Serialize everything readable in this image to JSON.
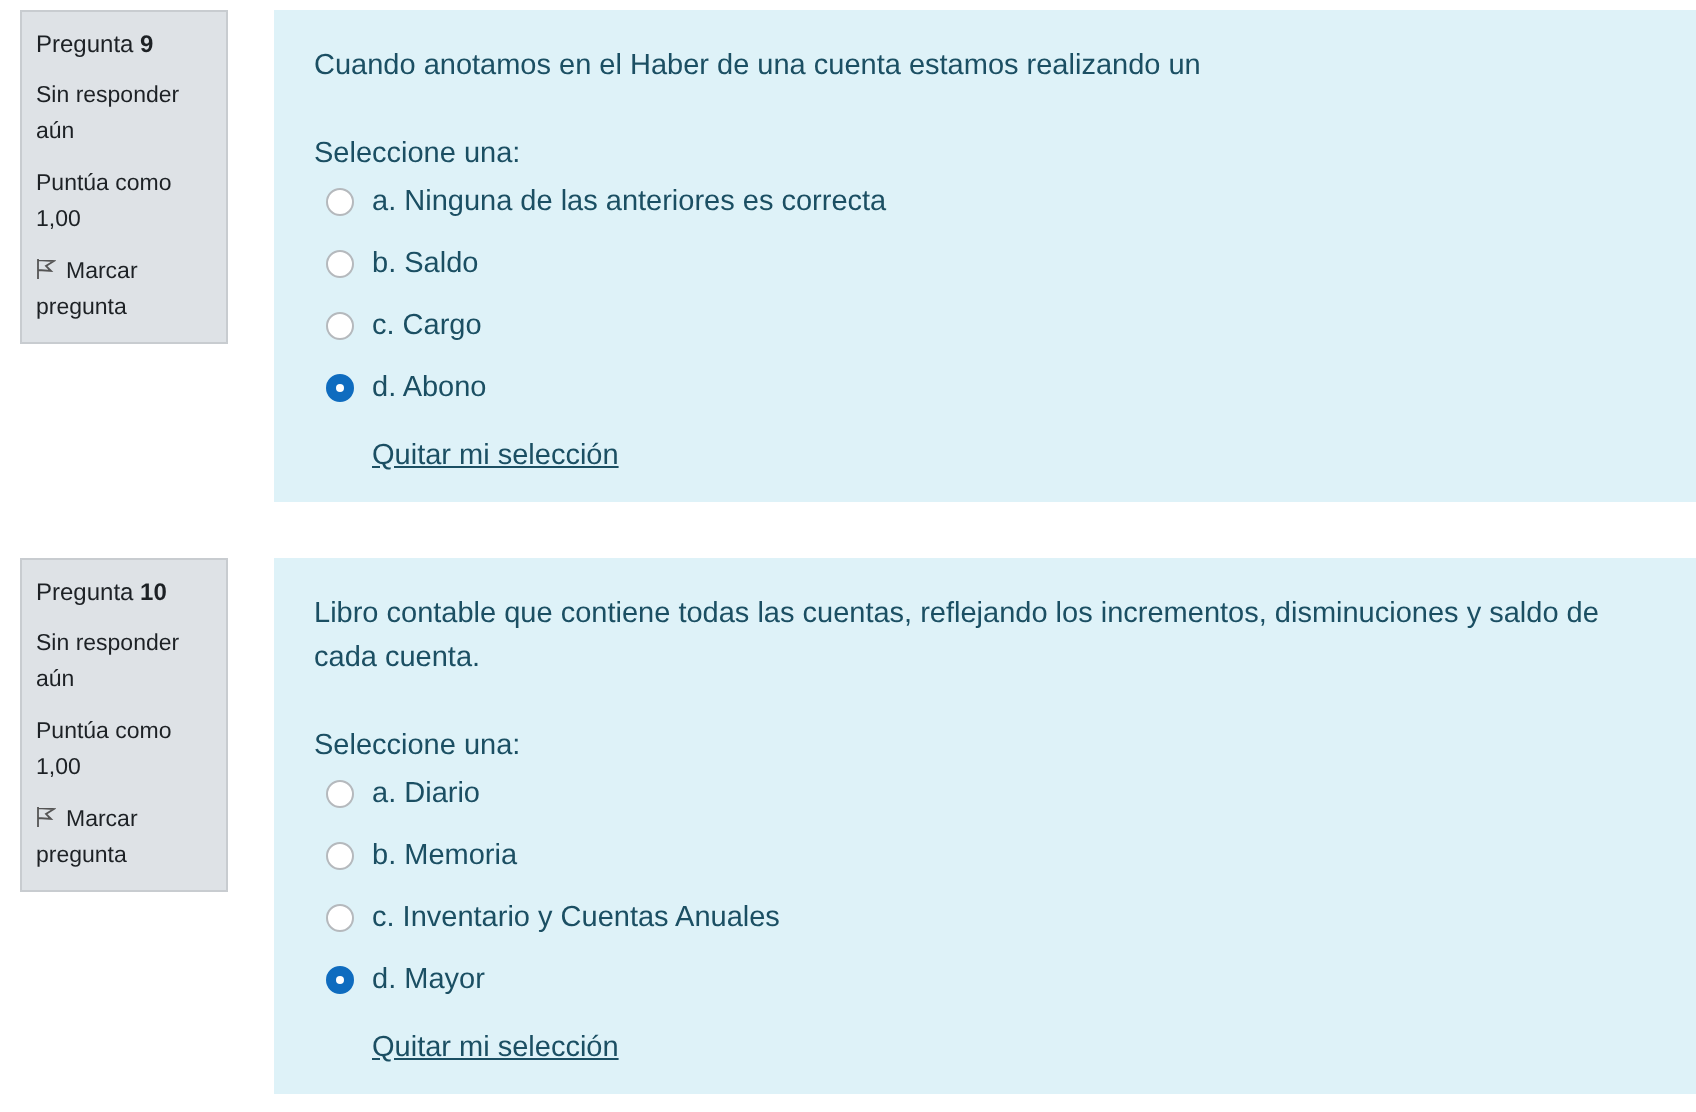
{
  "questions": [
    {
      "heading": "Pregunta **9**",
      "status": "Sin responder aún",
      "grade": "Puntúa como 1,00",
      "flag_label": "Marcar pregunta",
      "text": "Cuando anotamos en el Haber de una cuenta estamos realizando un",
      "prompt": "Seleccione una:",
      "options": [
        {
          "label": "a. Ninguna de las anteriores es correcta",
          "selected": false
        },
        {
          "label": "b. Saldo",
          "selected": false
        },
        {
          "label": "c. Cargo",
          "selected": false
        },
        {
          "label": "d. Abono",
          "selected": true
        }
      ],
      "clear_link": "Quitar mi selección"
    },
    {
      "heading": "Pregunta **10**",
      "status": "Sin responder aún",
      "grade": "Puntúa como 1,00",
      "flag_label": "Marcar pregunta",
      "text": "Libro contable que contiene todas las cuentas, reflejando los incrementos, disminuciones y saldo de cada cuenta.",
      "prompt": "Seleccione una:",
      "options": [
        {
          "label": "a. Diario",
          "selected": false
        },
        {
          "label": "b. Memoria",
          "selected": false
        },
        {
          "label": "c. Inventario y Cuentas Anuales",
          "selected": false
        },
        {
          "label": "d. Mayor",
          "selected": true
        }
      ],
      "clear_link": "Quitar mi selección"
    }
  ]
}
